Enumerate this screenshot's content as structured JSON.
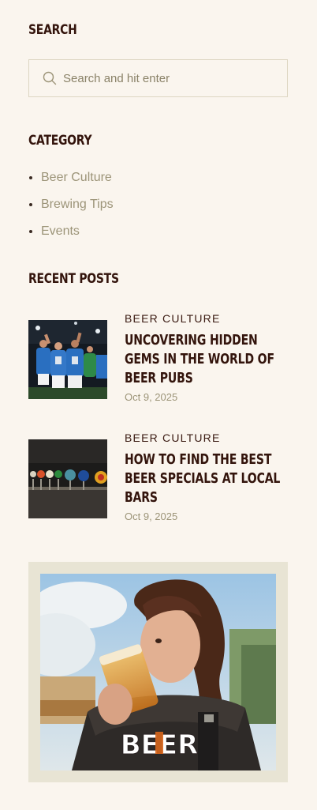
{
  "search": {
    "heading": "SEARCH",
    "placeholder": "Search and hit enter"
  },
  "category": {
    "heading": "CATEGORY",
    "items": [
      "Beer Culture",
      "Brewing Tips",
      "Events"
    ]
  },
  "recent_posts": {
    "heading": "RECENT POSTS",
    "posts": [
      {
        "category": "BEER CULTURE",
        "title": "UNCOVERING HIDDEN GEMS IN THE WORLD OF BEER PUBS",
        "date": "Oct 9, 2025"
      },
      {
        "category": "BEER CULTURE",
        "title": "HOW TO FIND THE BEST BEER SPECIALS AT LOCAL BARS",
        "date": "Oct 9, 2025"
      }
    ]
  },
  "banner": {
    "logo_text": "BEER"
  },
  "colors": {
    "background": "#faf5ee",
    "heading": "#33140c",
    "muted": "#9c9478",
    "border": "#ddd6c2",
    "banner_frame": "#e8e4d4"
  }
}
